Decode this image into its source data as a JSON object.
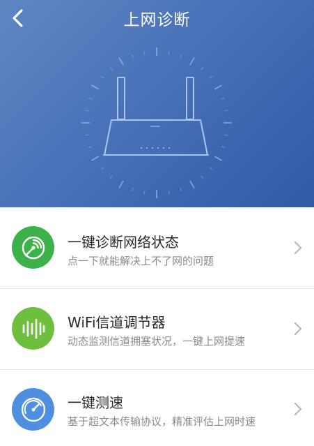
{
  "header": {
    "title": "上网诊断"
  },
  "colors": {
    "header_gradient_start": "#5f86c3",
    "header_gradient_end": "#2f5aa6",
    "diagnose_icon_bg": "#3db24a",
    "wifi_icon_bg": "#6fbf3f",
    "speed_icon_bg": "#4f8fe0"
  },
  "items": [
    {
      "title": "一键诊断网络状态",
      "subtitle": "点一下就能解决上不了网的问题",
      "icon": "radar-icon"
    },
    {
      "title": "WiFi信道调节器",
      "subtitle": "动态监测信道拥塞状况，一键上网提速",
      "icon": "signal-bars-icon"
    },
    {
      "title": "一键测速",
      "subtitle": "基于超文本传输协议，精准评估上网时速",
      "icon": "speedometer-icon"
    }
  ]
}
